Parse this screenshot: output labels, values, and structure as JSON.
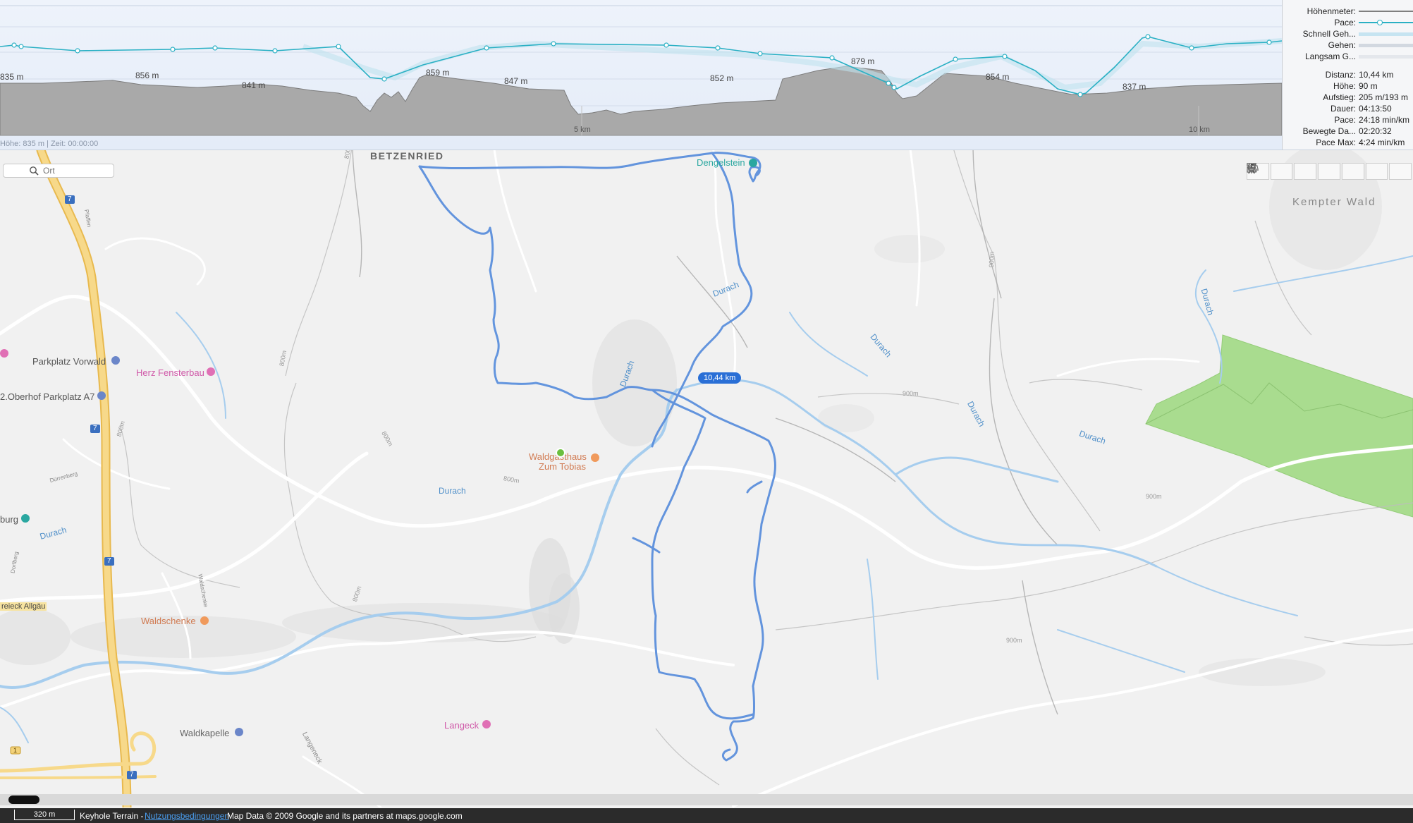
{
  "profile": {
    "elevation_labels": [
      "835 m",
      "856 m",
      "841 m",
      "859 m",
      "847 m",
      "852 m",
      "879 m",
      "854 m",
      "837 m"
    ],
    "axis_labels": [
      "5 km",
      "10 km"
    ],
    "cursor_status": "Höhe: 835 m | Zeit: 00:00:00",
    "colors": {
      "pace_line": "#2ab0c4",
      "elevation_fill": "#a9a9a9"
    }
  },
  "legend": [
    {
      "label": "Höhenmeter:",
      "swatch": "#7f7f7f"
    },
    {
      "label": "Pace:",
      "swatch": "#2ab0c4"
    },
    {
      "label": "Schnell Geh...",
      "swatch": "#c6e4f1"
    },
    {
      "label": "Gehen:",
      "swatch": "#d2d8e0"
    },
    {
      "label": "Langsam G...",
      "swatch": "#e4e7ec"
    }
  ],
  "stats": [
    {
      "label": "Distanz:",
      "value": "10,44 km"
    },
    {
      "label": "Höhe:",
      "value": "90 m"
    },
    {
      "label": "Aufstieg:",
      "value": "205 m/193 m"
    },
    {
      "label": "Dauer:",
      "value": "04:13:50"
    },
    {
      "label": "Pace:",
      "value": "24:18 min/km"
    },
    {
      "label": "Bewegte Da...",
      "value": "02:20:32"
    },
    {
      "label": "Pace Max:",
      "value": "4:24 min/km"
    }
  ],
  "search": {
    "placeholder": "Ort",
    "icon": "search-icon"
  },
  "tools": [
    {
      "name": "zoom-in-tool",
      "icon": "plus-icon"
    },
    {
      "name": "locate-tool",
      "icon": "location-arrow-icon"
    },
    {
      "name": "fullscreen-tool",
      "icon": "expand-icon"
    },
    {
      "name": "walking-tool",
      "icon": "walking-person-icon"
    },
    {
      "name": "car-tool",
      "icon": "car-icon"
    },
    {
      "name": "balloon-tool",
      "icon": "balloon-icon"
    },
    {
      "name": "zoom-out-tool",
      "icon": "minus-icon"
    }
  ],
  "map": {
    "distance_badge": "10,44 km",
    "places": {
      "betzenried": "BETZENRIED",
      "kempter_wald": "Kempter Wald",
      "dengelstein": "Dengelstein",
      "parkplatz_vorwald": "Parkplatz Vorwald",
      "herz_fensterbau": "Herz Fensterbau",
      "oberhof_parkplatz": "2.Oberhof Parkplatz A7",
      "waldgasthaus_1": "Waldgasthaus",
      "waldgasthaus_2": "Zum Tobias",
      "waldschenke": "Waldschenke",
      "langeck": "Langeck",
      "waldkapelle": "Waldkapelle",
      "dreieck": "reieck Allgäu",
      "burg": "burg"
    },
    "rivers": [
      "Durach",
      "Durach",
      "Durach",
      "Durach",
      "Durach",
      "Durach",
      "Durach",
      "Durach"
    ],
    "contours": [
      "800m",
      "800m",
      "800m",
      "800m",
      "800m",
      "800m",
      "900m",
      "900m",
      "900m",
      "900m"
    ],
    "roads": [
      "7",
      "7",
      "7",
      "7",
      "1"
    ],
    "streets": [
      "Pfaffen",
      "Dürrenberg",
      "Dorfberg",
      "Waldschenke",
      "Langeneck"
    ],
    "colors": {
      "route": "#5b8fdc",
      "river": "#a6cdee",
      "forest": "#a9dc8f",
      "motorway": "#f3d27a",
      "road": "#ffffff"
    }
  },
  "footer": {
    "scale": "320 m",
    "source": "Keyhole Terrain - ",
    "terms": "Nutzungsbedingungen",
    "attribution": " Map Data © 2009 Google and its partners at maps.google.com"
  }
}
